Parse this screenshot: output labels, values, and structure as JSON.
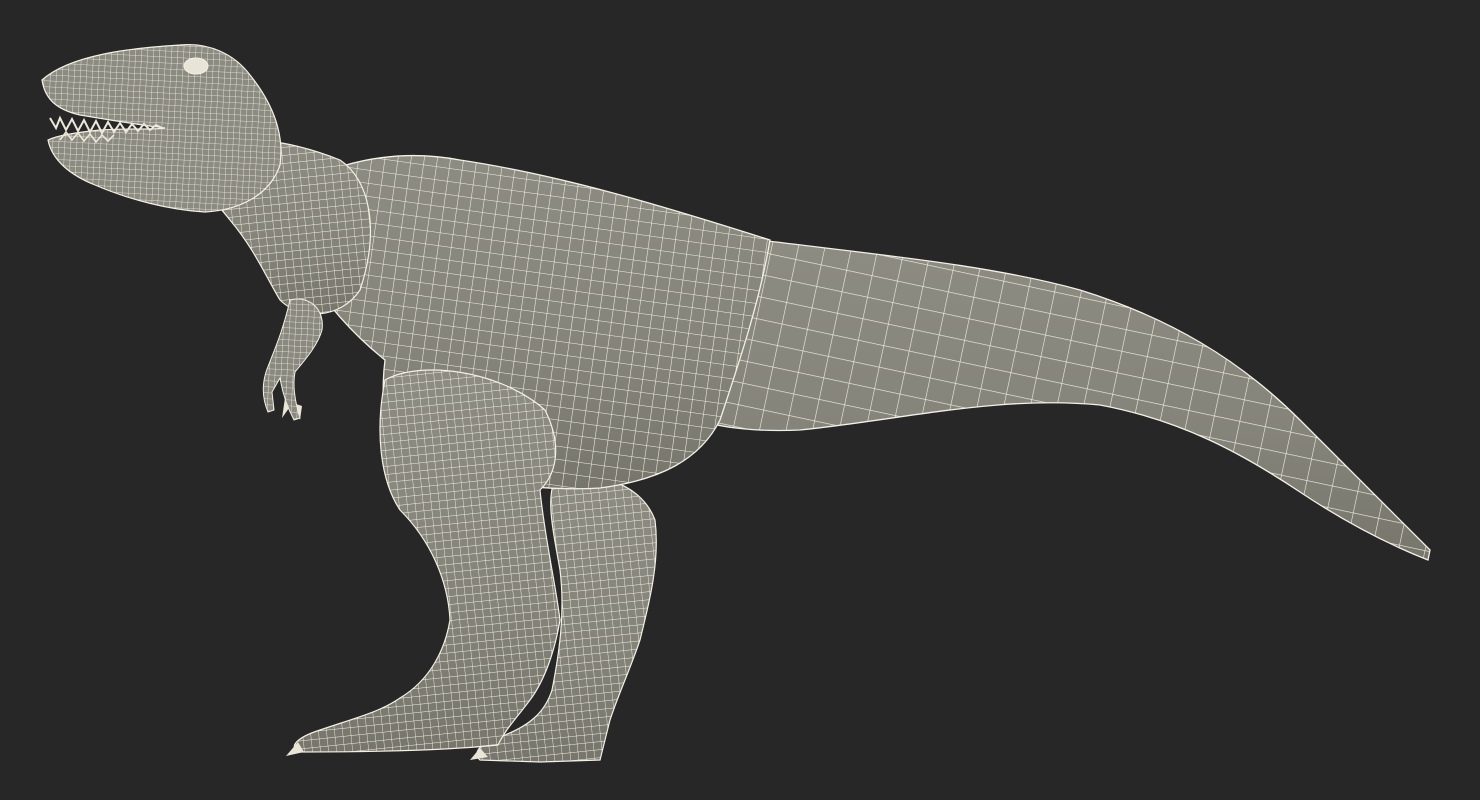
{
  "scene": {
    "subject": "t-rex-wireframe-model",
    "view": "side-view",
    "shading": "wireframe-over-solid"
  },
  "colors": {
    "background": "#272727",
    "mesh_fill": "#85847a",
    "mesh_fill_light": "#9a9a8e",
    "mesh_fill_dark": "#6f6e64",
    "wire": "#f3f0e4",
    "teeth": "#e9e6d8"
  }
}
